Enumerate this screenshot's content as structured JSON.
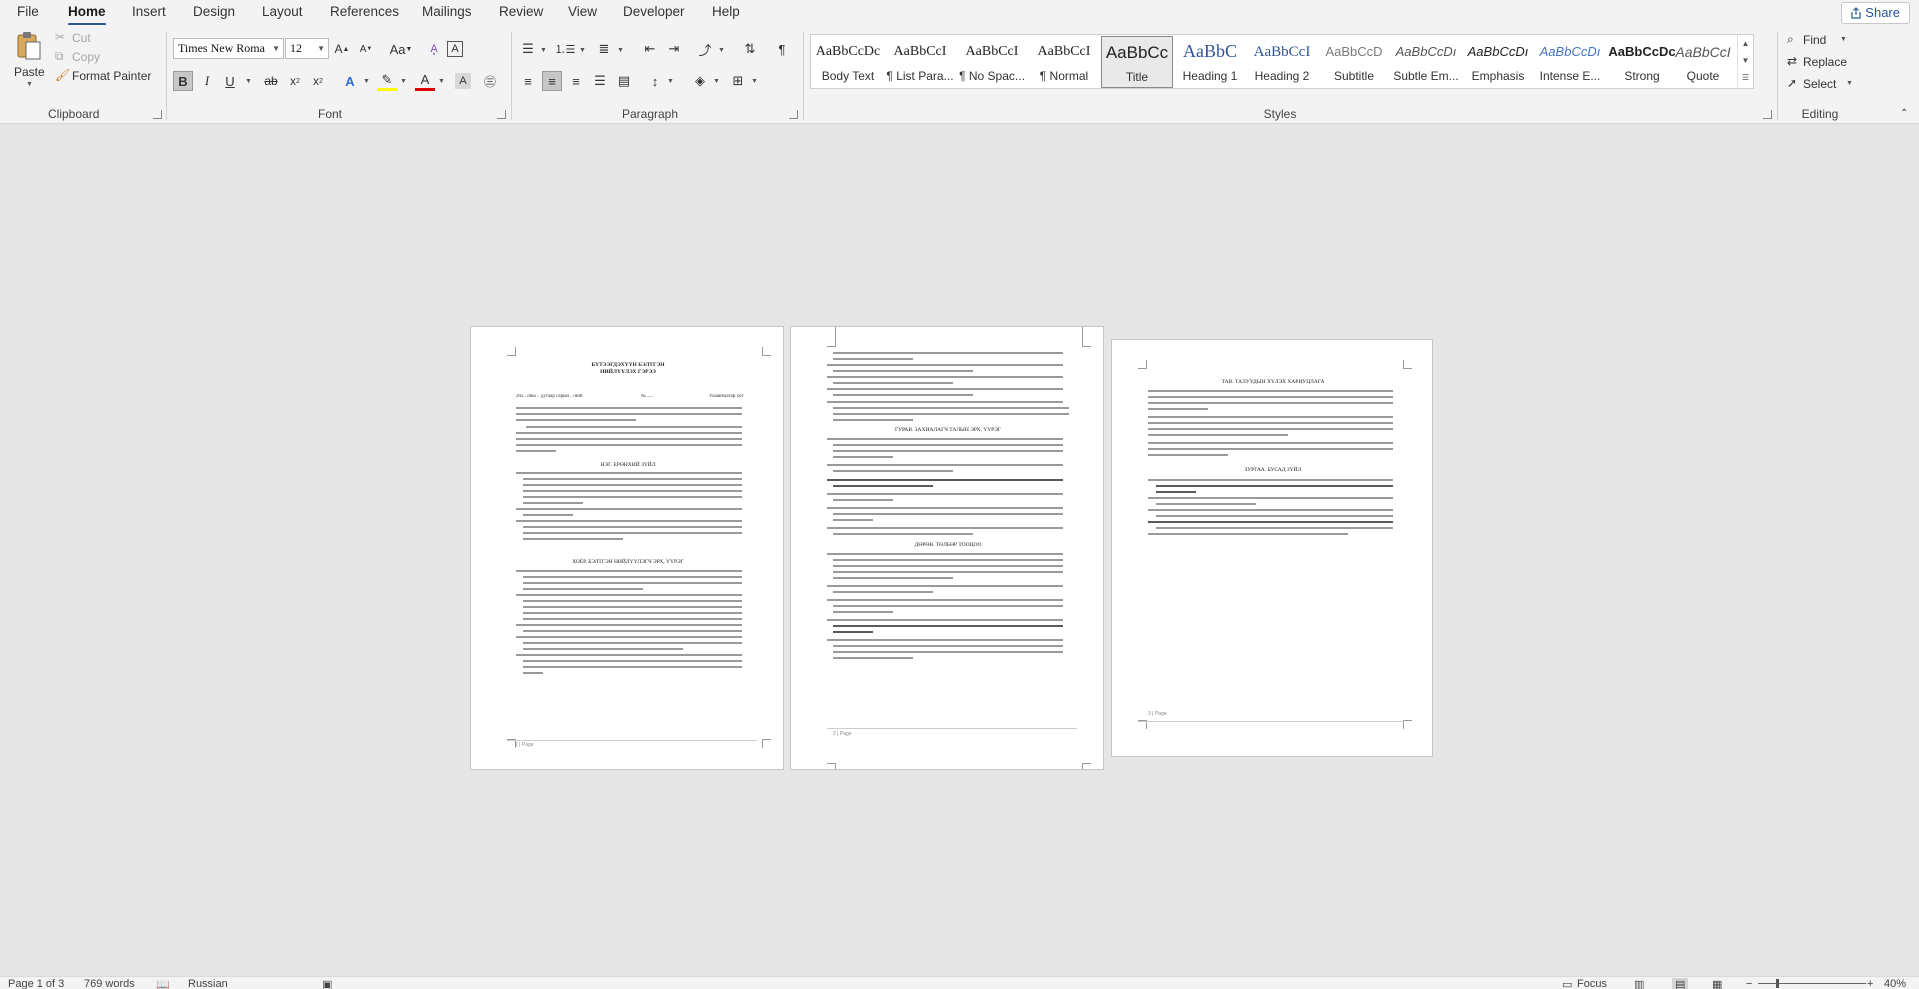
{
  "menu": {
    "tabs": [
      "File",
      "Home",
      "Insert",
      "Design",
      "Layout",
      "References",
      "Mailings",
      "Review",
      "View",
      "Developer",
      "Help"
    ],
    "active_tab": "Home",
    "share_label": "Share"
  },
  "ribbon": {
    "clipboard": {
      "label": "Clipboard",
      "paste": "Paste",
      "cut": "Cut",
      "copy": "Copy",
      "format_painter": "Format Painter"
    },
    "font": {
      "label": "Font",
      "font_name": "Times New Roma",
      "font_size": "12"
    },
    "paragraph": {
      "label": "Paragraph"
    },
    "styles": {
      "label": "Styles",
      "items": [
        {
          "preview": "AaBbCcDc",
          "name": "Body Text"
        },
        {
          "preview": "AaBbCcI",
          "name": "¶ List Para..."
        },
        {
          "preview": "AaBbCcI",
          "name": "¶ No Spac..."
        },
        {
          "preview": "AaBbCcI",
          "name": "¶ Normal"
        },
        {
          "preview": "AaBbCc",
          "name": "Title"
        },
        {
          "preview": "AaBbC",
          "name": "Heading 1"
        },
        {
          "preview": "AaBbCcI",
          "name": "Heading 2"
        },
        {
          "preview": "AaBbCcD",
          "name": "Subtitle"
        },
        {
          "preview": "AaBbCcDı",
          "name": "Subtle Em..."
        },
        {
          "preview": "AaBbCcDı",
          "name": "Emphasis"
        },
        {
          "preview": "AaBbCcDı",
          "name": "Intense E..."
        },
        {
          "preview": "AaBbCcDc",
          "name": "Strong"
        },
        {
          "preview": "AaBbCcI",
          "name": "Quote"
        }
      ],
      "selected": "Title"
    },
    "editing": {
      "label": "Editing",
      "find": "Find",
      "replace": "Replace",
      "select": "Select"
    }
  },
  "document": {
    "page1": {
      "title_line1": "БҮТЭЭГДЭХҮҮН БЭЛТГЭН",
      "title_line2": "НИЙЛҮҮЛЭХ ГЭРЭЭ",
      "date_line": "202.. оны .. дугаар сарын ..-ний",
      "number": "№ .....",
      "city": "Улаанбаатар хот",
      "section1": "НЭГ. ЕРӨНХИЙ ЗҮЙЛ",
      "section2": "ХОЁР. БЭЛТГЭН НИЙЛҮҮЛЭГЧ ЭРХ, ҮҮРЭГ",
      "footer": "1 | Page"
    },
    "page2": {
      "section3": "ГУРАВ. ЗАХИАЛАГЧ ТАЛЫН ЭРХ, ҮҮРЭГ",
      "section4": "ДӨРӨВ. ТӨЛБӨР ТООЦОО",
      "footer": "2 | Page"
    },
    "page3": {
      "section5": "ТАВ. ТАЛУУДЫН ХҮЛЭХ ХАРИУЦЛАГА",
      "section6": "ЗУРГАА. БУСАД ЗҮЙЛ",
      "footer": "3 | Page"
    }
  },
  "status": {
    "page": "Page 1 of 3",
    "words": "769 words",
    "language": "Russian",
    "focus": "Focus",
    "zoom": "40%"
  },
  "colors": {
    "accent": "#2b579a",
    "ribbon_bg": "#f3f3f3",
    "doc_bg": "#e6e6e6",
    "highlight": "#ffff00",
    "font_color": "#e00000"
  }
}
